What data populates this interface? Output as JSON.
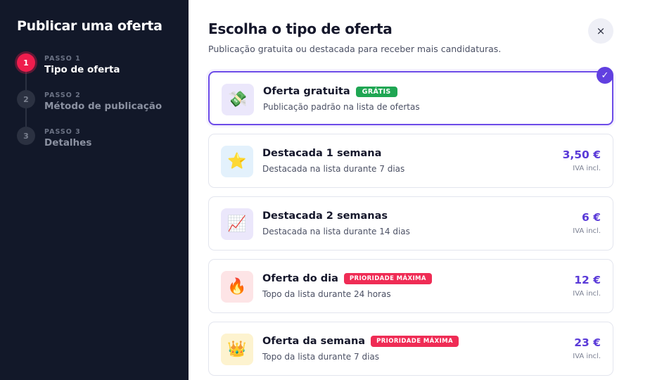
{
  "sidebar": {
    "title": "Publicar uma oferta",
    "steps": [
      {
        "number": "1",
        "kicker": "PASSO 1",
        "label": "Tipo de oferta",
        "active": true
      },
      {
        "number": "2",
        "kicker": "PASSO 2",
        "label": "Método de publicação",
        "active": false
      },
      {
        "number": "3",
        "kicker": "PASSO 3",
        "label": "Detalhes",
        "active": false
      }
    ]
  },
  "main": {
    "title": "Escolha o tipo de oferta",
    "subtitle": "Publicação gratuita ou destacada para receber mais candidaturas.",
    "close_icon": "×",
    "check_icon": "✓"
  },
  "options": [
    {
      "title": "Oferta gratuita",
      "badge": "GRÁTIS",
      "description": "Publicação padrão na lista de ofertas",
      "price": "",
      "vat": "",
      "icon": "💸",
      "icon_name": "money-with-wings-icon",
      "icon_bg": "#ebe7fb",
      "selected": true
    },
    {
      "title": "Destacada 1 semana",
      "badge": "",
      "description": "Destacada na lista durante 7 dias",
      "price": "3,50 €",
      "vat": "IVA incl.",
      "icon": "⭐",
      "icon_name": "star-icon",
      "icon_bg": "#e3f1fc",
      "selected": false
    },
    {
      "title": "Destacada 2 semanas",
      "badge": "",
      "description": "Destacada na lista durante 14 dias",
      "price": "6 €",
      "vat": "IVA incl.",
      "icon": "📈",
      "icon_name": "chart-increasing-icon",
      "icon_bg": "#ebe7fb",
      "selected": false
    },
    {
      "title": "Oferta do dia",
      "badge": "PRIORIDADE MÁXIMA",
      "description": "Topo da lista durante 24 horas",
      "price": "12 €",
      "vat": "IVA incl.",
      "icon": "🔥",
      "icon_name": "fire-icon",
      "icon_bg": "#fde4e6",
      "selected": false
    },
    {
      "title": "Oferta da semana",
      "badge": "PRIORIDADE MÁXIMA",
      "description": "Topo da lista durante 7 dias",
      "price": "23 €",
      "vat": "IVA incl.",
      "icon": "👑",
      "icon_name": "crown-icon",
      "icon_bg": "#fdf3cf",
      "selected": false
    }
  ],
  "colors": {
    "sidebar_bg": "#121829",
    "active_step": "#ef1d4d",
    "accent_purple": "#6140e0",
    "price": "#5a3ad8",
    "badge_free": "#1fa653",
    "badge_priority": "#ef2c55"
  }
}
